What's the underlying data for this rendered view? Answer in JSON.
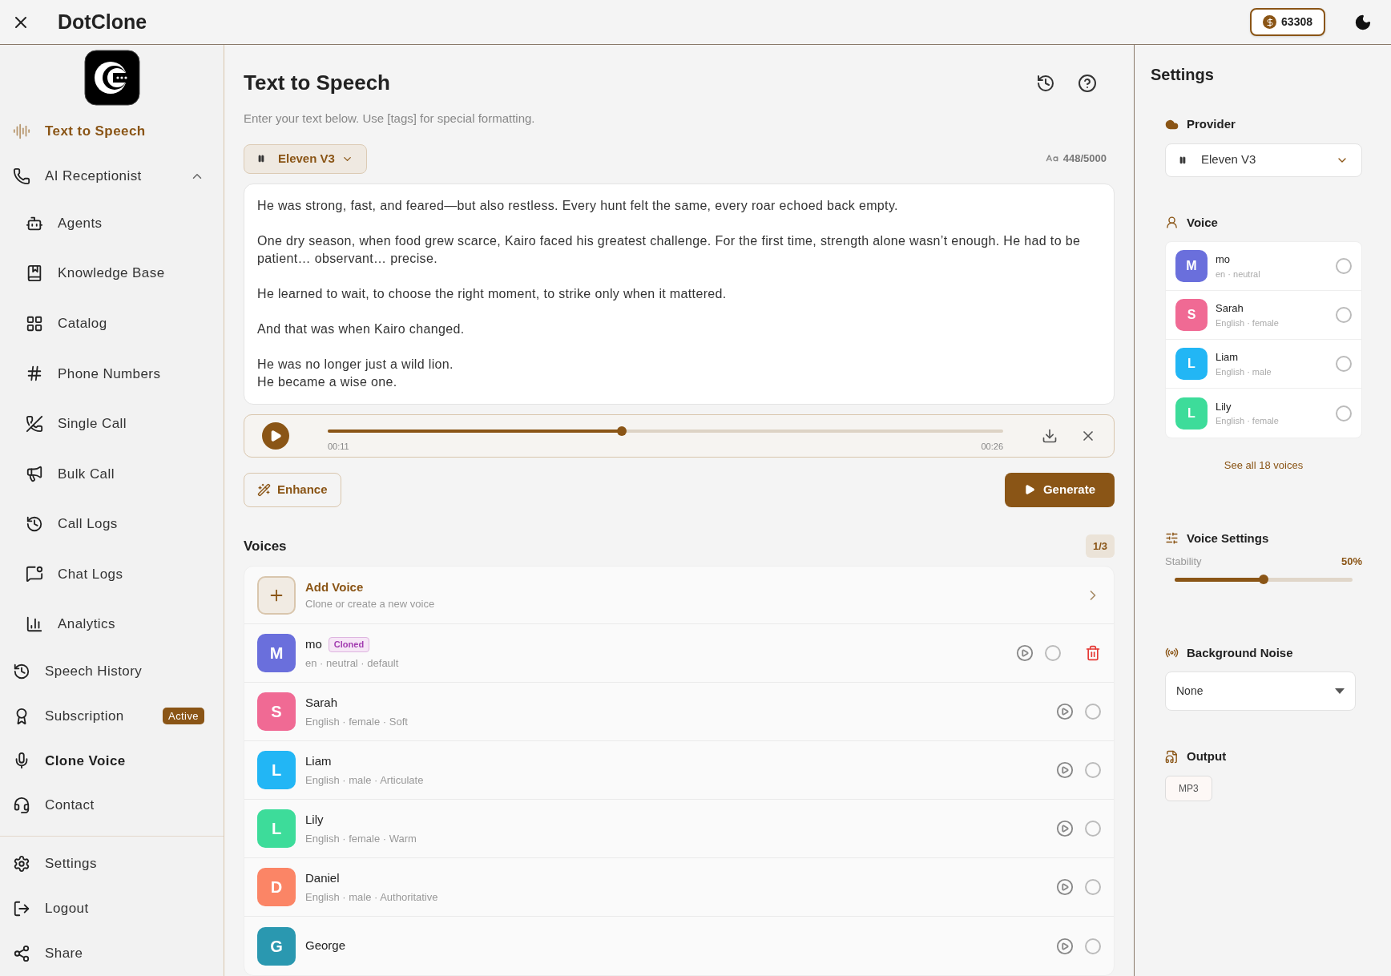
{
  "header": {
    "title": "DotClone",
    "credits": "63308"
  },
  "sidebar": {
    "items": [
      {
        "label": "Text to Speech",
        "selected": true,
        "bold": true
      },
      {
        "label": "AI Receptionist",
        "selected": false,
        "bold": false,
        "expanded": true,
        "children": [
          {
            "label": "Agents",
            "selected": false
          },
          {
            "label": "Knowledge Base",
            "selected": false
          },
          {
            "label": "Catalog",
            "selected": false
          },
          {
            "label": "Phone Numbers",
            "selected": false
          },
          {
            "label": "Single Call",
            "selected": false
          },
          {
            "label": "Bulk Call",
            "selected": false
          },
          {
            "label": "Call Logs",
            "selected": false
          },
          {
            "label": "Chat Logs",
            "selected": false
          },
          {
            "label": "Analytics",
            "selected": false
          }
        ]
      },
      {
        "label": "Speech History",
        "selected": false,
        "bold": false
      },
      {
        "label": "Subscription",
        "selected": false,
        "bold": false,
        "badge": "Active"
      },
      {
        "label": "Clone Voice",
        "selected": false,
        "bold": true
      },
      {
        "label": "Contact",
        "selected": false,
        "bold": false
      }
    ],
    "bottom_items": [
      {
        "label": "Settings"
      },
      {
        "label": "Logout"
      },
      {
        "label": "Share"
      }
    ]
  },
  "main": {
    "title": "Text to Speech",
    "subtitle": "Enter your text below. Use [tags] for special formatting.",
    "model": "Eleven V3",
    "char_count": "448/5000",
    "text": "He was strong, fast, and feared—but also restless. Every hunt felt the same, every roar echoed back empty.\n\nOne dry season, when food grew scarce, Kairo faced his greatest challenge. For the first time, strength alone wasn’t enough. He had to be patient… observant… precise.\n\nHe learned to wait, to choose the right moment, to strike only when it mattered.\n\nAnd that was when Kairo changed.\n\nHe was no longer just a wild lion.\nHe became a wise one.",
    "player": {
      "level": 0.435,
      "current": "00:11",
      "total": "00:26"
    },
    "enhance": "Enhance",
    "generate": "Generate",
    "voices": {
      "title": "Voices",
      "page": "1/3",
      "add": {
        "title": "Add Voice",
        "subtitle": "Clone or create a new voice"
      },
      "items": [
        {
          "initial": "M",
          "name": "mo",
          "badge": "Cloned",
          "details": "en · neutral · default",
          "color": "#6a6fdc",
          "selected": false,
          "deletable": true
        },
        {
          "initial": "S",
          "name": "Sarah",
          "details": "English · female · Soft",
          "color": "#f06a94",
          "selected": false,
          "deletable": false
        },
        {
          "initial": "L",
          "name": "Liam",
          "details": "English · male · Articulate",
          "color": "#22b6f5",
          "selected": false,
          "deletable": false
        },
        {
          "initial": "L",
          "name": "Lily",
          "details": "English · female · Warm",
          "color": "#3ddc9a",
          "selected": false,
          "deletable": false
        },
        {
          "initial": "D",
          "name": "Daniel",
          "details": "English · male · Authoritative",
          "color": "#fb8566",
          "selected": false,
          "deletable": false
        },
        {
          "initial": "G",
          "name": "George",
          "color": "#2a98b0",
          "selected": false,
          "deletable": false
        }
      ]
    }
  },
  "settings": {
    "title": "Settings",
    "provider": {
      "label": "Provider",
      "value": "Eleven V3"
    },
    "voice": {
      "label": "Voice",
      "items": [
        {
          "initial": "M",
          "name": "mo",
          "details": "en · neutral",
          "color": "#6a6fdc",
          "selected": false
        },
        {
          "initial": "S",
          "name": "Sarah",
          "details": "English · female",
          "color": "#f06a94",
          "selected": false
        },
        {
          "initial": "L",
          "name": "Liam",
          "details": "English · male",
          "color": "#22b6f5",
          "selected": false
        },
        {
          "initial": "L",
          "name": "Lily",
          "details": "English · female",
          "color": "#3ddc9a",
          "selected": false
        }
      ],
      "see_all": "See all 18 voices"
    },
    "voice_settings": {
      "label": "Voice Settings",
      "stability": {
        "label": "Stability",
        "reading": "50%",
        "level": 0.5
      }
    },
    "background_noise": {
      "label": "Background Noise",
      "value": "None"
    },
    "output": {
      "label": "Output",
      "format": "MP3"
    }
  }
}
